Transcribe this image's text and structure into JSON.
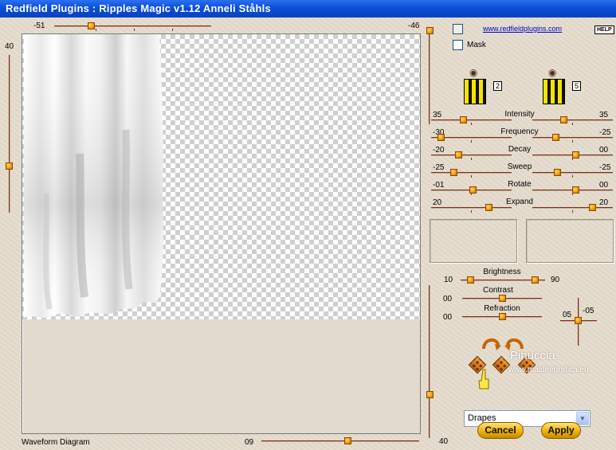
{
  "window": {
    "title": "Redfield Plugins : Ripples Magic v1.12   Anneli Ståhls"
  },
  "top_slider": {
    "value": "-51",
    "right_value": "-46"
  },
  "left_slider": {
    "value": "40"
  },
  "right_preview_slider": {
    "value": "40"
  },
  "bottom": {
    "waveform_label": "Waveform Diagram",
    "slider_value": "09"
  },
  "header": {
    "link": "www.redfieldplugins.com",
    "help": "HELP",
    "mask_label": "Mask"
  },
  "swatches": {
    "left_number": "2",
    "right_number": "5"
  },
  "params": [
    {
      "label": "Intensity",
      "left": "35",
      "right": "35"
    },
    {
      "label": "Frequency",
      "left": "-30",
      "right": "-25"
    },
    {
      "label": "Decay",
      "left": "-20",
      "right": "00"
    },
    {
      "label": "Sweep",
      "left": "-25",
      "right": "-25"
    },
    {
      "label": "Rotate",
      "left": "-01",
      "right": "00"
    },
    {
      "label": "Expand",
      "left": "20",
      "right": "20"
    }
  ],
  "lighting": {
    "brightness_label": "Brightness",
    "brightness_left": "10",
    "brightness_right": "90",
    "contrast_label": "Contrast",
    "contrast_value": "00",
    "refraction_label": "Refraction",
    "refraction_value": "00",
    "cross_x": "05",
    "cross_y": "-05"
  },
  "preset": {
    "selected": "Drapes"
  },
  "buttons": {
    "cancel": "Cancel",
    "apply": "Apply"
  },
  "watermark": {
    "name": "Pinuccia",
    "url": "www.maidiregrafica.eu"
  }
}
